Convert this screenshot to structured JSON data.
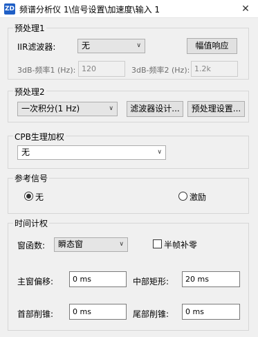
{
  "window": {
    "icon_text": "ZD",
    "title": "频谱分析仪 1\\信号设置\\加速度\\输入 1",
    "close_glyph": "✕"
  },
  "preprocess1": {
    "title": "预处理1",
    "iir_label": "IIR滤波器:",
    "iir_value": "无",
    "freq_response_button": "幅值响应",
    "freq1_label": "3dB-频率1 (Hz):",
    "freq1_value": "120",
    "freq2_label": "3dB-频率2 (Hz):",
    "freq2_value": "1.2k"
  },
  "preprocess2": {
    "title": "预处理2",
    "integration_value": "一次积分(1 Hz)",
    "filter_design_button": "滤波器设计...",
    "preprocess_settings_button": "预处理设置..."
  },
  "cpb": {
    "title": "CPB生理加权",
    "weighting_value": "无"
  },
  "reference": {
    "title": "参考信号",
    "option_none": "无",
    "option_excitation": "激励",
    "selected": "无"
  },
  "time_weighting": {
    "title": "时间计权",
    "window_label": "窗函数:",
    "window_value": "瞬态窗",
    "half_frame_label": "半帧补零",
    "half_frame_checked": false,
    "main_offset_label": "主窗偏移:",
    "main_offset_value": "0 ms",
    "middle_rect_label": "中部矩形:",
    "middle_rect_value": "20 ms",
    "head_taper_label": "首部削锥:",
    "head_taper_value": "0 ms",
    "tail_taper_label": "尾部削锥:",
    "tail_taper_value": "0 ms"
  },
  "icons": {
    "combo_chevron": "∨"
  }
}
